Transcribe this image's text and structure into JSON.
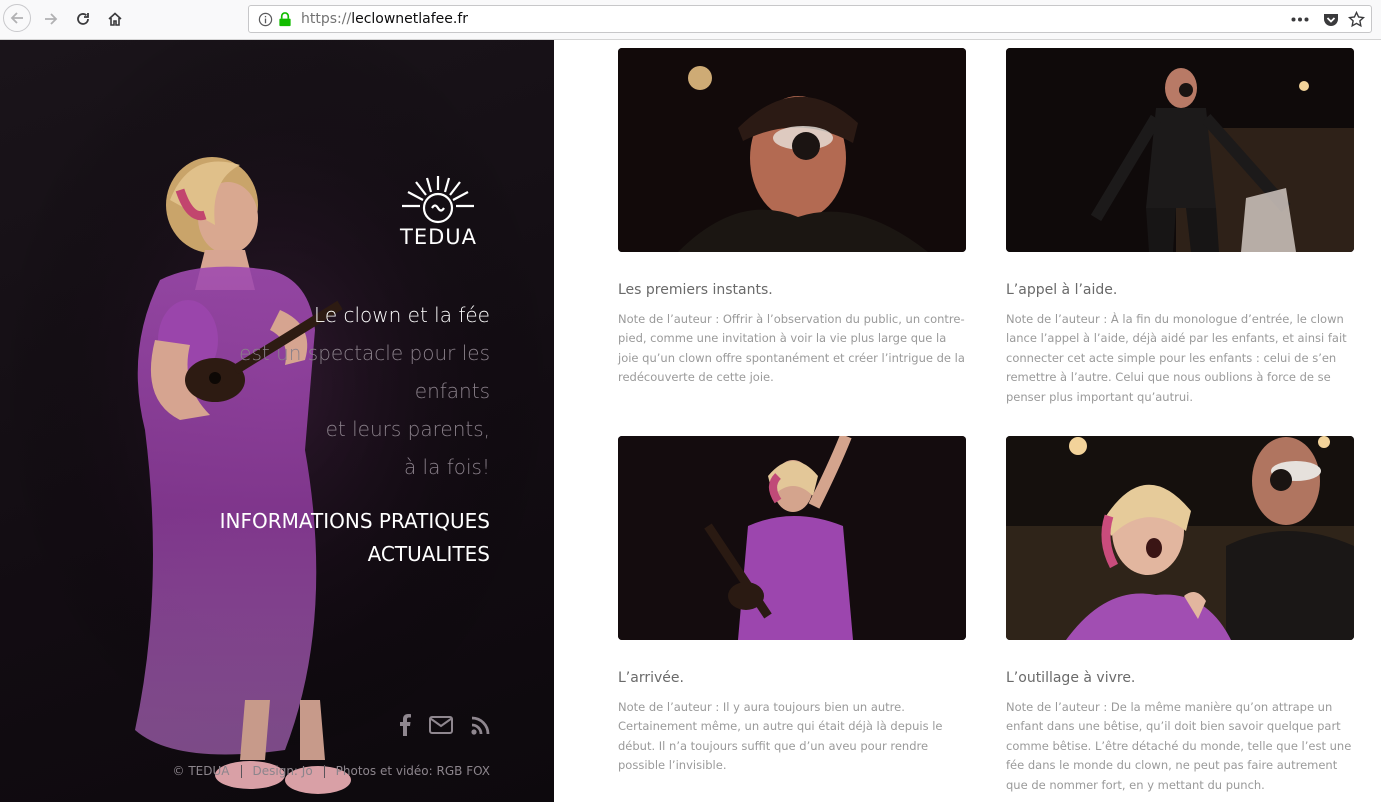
{
  "browser": {
    "url_scheme": "https://",
    "url_host": "leclownetlafee.fr"
  },
  "hero": {
    "logo_text": "TEDUA",
    "tagline": [
      "Le clown et la fée",
      "est un spectacle pour les",
      "enfants",
      "et leurs parents,",
      "à la fois!"
    ],
    "menu": [
      "INFORMATIONS PRATIQUES",
      "ACTUALITES"
    ],
    "social_icons": [
      "facebook-icon",
      "mail-icon",
      "rss-icon"
    ],
    "footer": [
      "© TEDUA",
      "Design: Jo",
      "Photos et vidéo: RGB FOX"
    ]
  },
  "cards": [
    {
      "title": "Les premiers instants.",
      "text": "Note de l’auteur : Offrir à l’observation du public, un contre-pied, comme une invitation à voir la vie plus large que la joie qu’un clown offre spontanément et créer l’intrigue de la redécouverte de cette joie."
    },
    {
      "title": "L’appel à l’aide.",
      "text": "Note de l’auteur : À la fin du monologue d’entrée, le clown lance l’appel à l’aide, déjà aidé par les enfants, et ainsi fait connecter cet acte simple pour les enfants : celui de s’en remettre à l’autre. Celui que nous oublions à force de se penser plus important qu’autrui."
    },
    {
      "title": "L’arrivée.",
      "text": "Note de l’auteur : Il y aura toujours bien un autre. Certainement même, un autre qui était déjà là depuis le début. Il n’a toujours suffit que d’un aveu pour rendre possible l’invisible."
    },
    {
      "title": "L’outillage à vivre.",
      "text": "Note de l’auteur : De la même manière qu’on attrape un enfant dans une bêtise, qu’il doit bien savoir quelque part comme bêtise. L’être détaché du monde, telle que l’est une fée dans le monde du clown, ne peut pas faire autrement que de nommer fort, en y mettant du punch."
    }
  ]
}
